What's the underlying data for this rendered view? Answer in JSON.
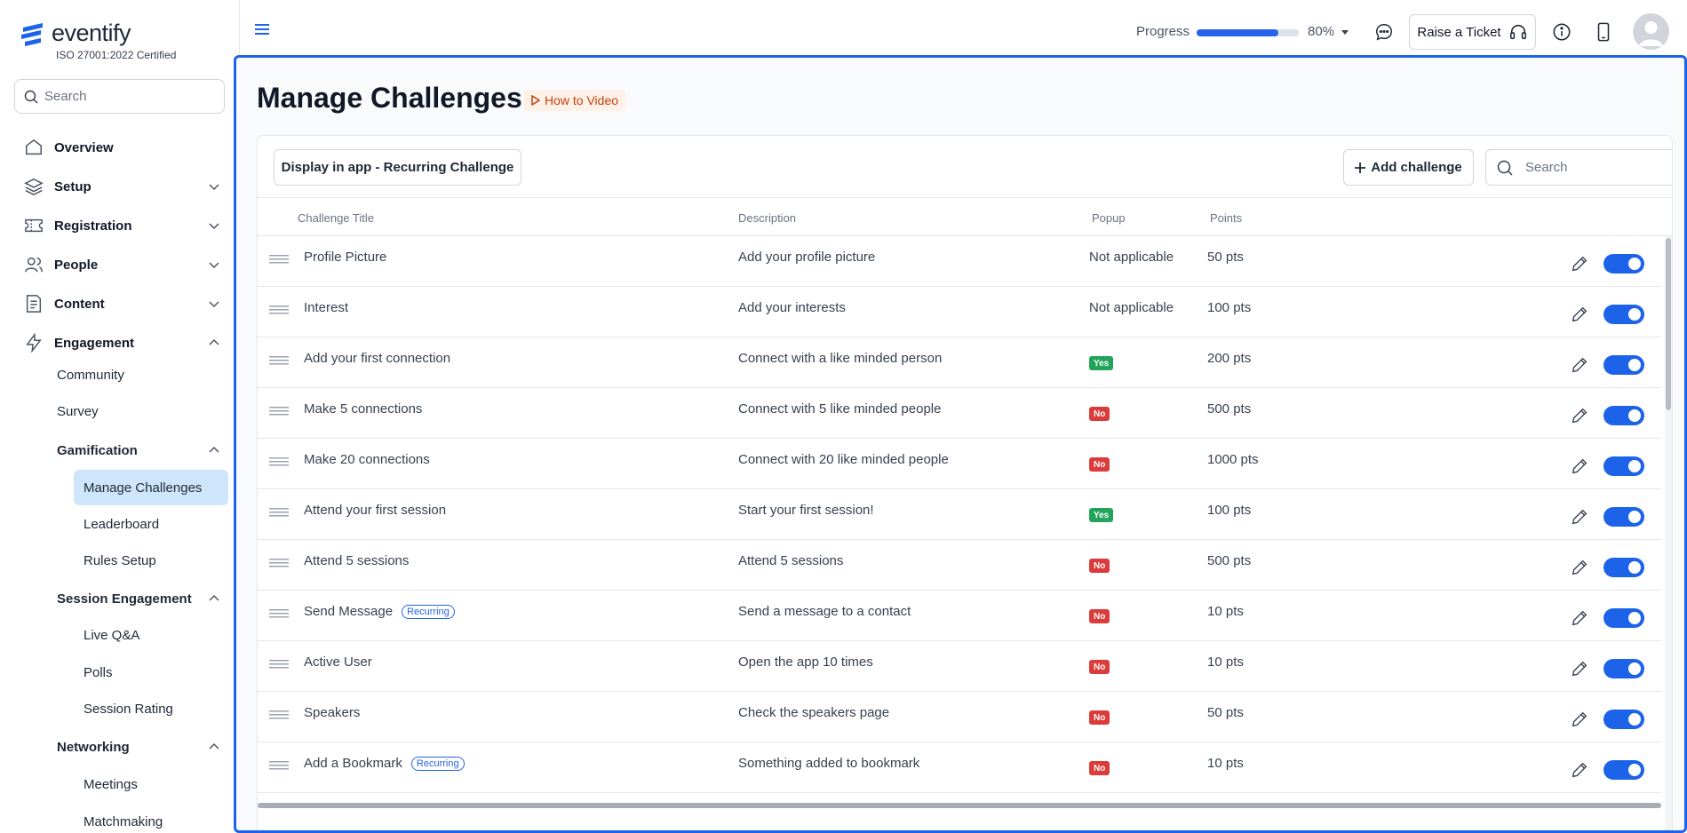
{
  "brand": {
    "name": "eventify",
    "certification": "ISO 27001:2022 Certified",
    "color": "#1d63e9"
  },
  "sidebar": {
    "search_placeholder": "Search",
    "nav": [
      {
        "label": "Overview",
        "icon": "home-icon"
      },
      {
        "label": "Setup",
        "icon": "layers-icon"
      },
      {
        "label": "Registration",
        "icon": "ticket-icon"
      },
      {
        "label": "People",
        "icon": "users-icon"
      },
      {
        "label": "Content",
        "icon": "document-icon"
      },
      {
        "label": "Engagement",
        "icon": "lightning-icon"
      }
    ],
    "engagement_items": [
      "Community",
      "Survey"
    ],
    "gamification": {
      "label": "Gamification",
      "items": [
        "Manage Challenges",
        "Leaderboard",
        "Rules Setup"
      ],
      "active": "Manage Challenges"
    },
    "session_engagement": {
      "label": "Session Engagement",
      "items": [
        "Live Q&A",
        "Polls",
        "Session Rating"
      ]
    },
    "networking": {
      "label": "Networking",
      "items": [
        "Meetings",
        "Matchmaking"
      ]
    }
  },
  "topbar": {
    "progress_label": "Progress",
    "progress_percent_text": "80%",
    "progress_value": 0.8,
    "ticket_label": "Raise a Ticket"
  },
  "page": {
    "title": "Manage Challenges",
    "how_to": "How to Video",
    "display_button": "Display in app - Recurring Challenge",
    "add_button": "Add challenge",
    "search_placeholder": "Search"
  },
  "table": {
    "columns": [
      "Challenge Title",
      "Description",
      "Popup",
      "Points"
    ],
    "rows": [
      {
        "title": "Profile Picture",
        "recurring": "",
        "description": "Add your profile picture",
        "popup": "Not applicable",
        "popup_type": "text",
        "points": "50 pts"
      },
      {
        "title": "Interest",
        "recurring": "",
        "description": "Add your interests",
        "popup": "Not applicable",
        "popup_type": "text",
        "points": "100 pts"
      },
      {
        "title": "Add your first connection",
        "recurring": "",
        "description": "Connect with a like minded person",
        "popup": "Yes",
        "popup_type": "yes",
        "points": "200 pts"
      },
      {
        "title": "Make 5 connections",
        "recurring": "",
        "description": "Connect with 5 like minded people",
        "popup": "No",
        "popup_type": "no",
        "points": "500 pts"
      },
      {
        "title": "Make 20 connections",
        "recurring": "",
        "description": "Connect with 20 like minded people",
        "popup": "No",
        "popup_type": "no",
        "points": "1000 pts"
      },
      {
        "title": "Attend your first session",
        "recurring": "",
        "description": "Start your first session!",
        "popup": "Yes",
        "popup_type": "yes",
        "points": "100 pts"
      },
      {
        "title": "Attend 5 sessions",
        "recurring": "",
        "description": "Attend 5 sessions",
        "popup": "No",
        "popup_type": "no",
        "points": "500 pts"
      },
      {
        "title": "Send Message",
        "recurring": "Recurring",
        "description": "Send a message to a contact",
        "popup": "No",
        "popup_type": "no",
        "points": "10 pts"
      },
      {
        "title": "Active User",
        "recurring": "",
        "description": "Open the app 10 times",
        "popup": "No",
        "popup_type": "no",
        "points": "10 pts"
      },
      {
        "title": "Speakers",
        "recurring": "",
        "description": "Check the speakers page",
        "popup": "No",
        "popup_type": "no",
        "points": "50 pts"
      },
      {
        "title": "Add a Bookmark",
        "recurring": "Recurring",
        "description": "Something added to bookmark",
        "popup": "No",
        "popup_type": "no",
        "points": "10 pts"
      }
    ]
  }
}
